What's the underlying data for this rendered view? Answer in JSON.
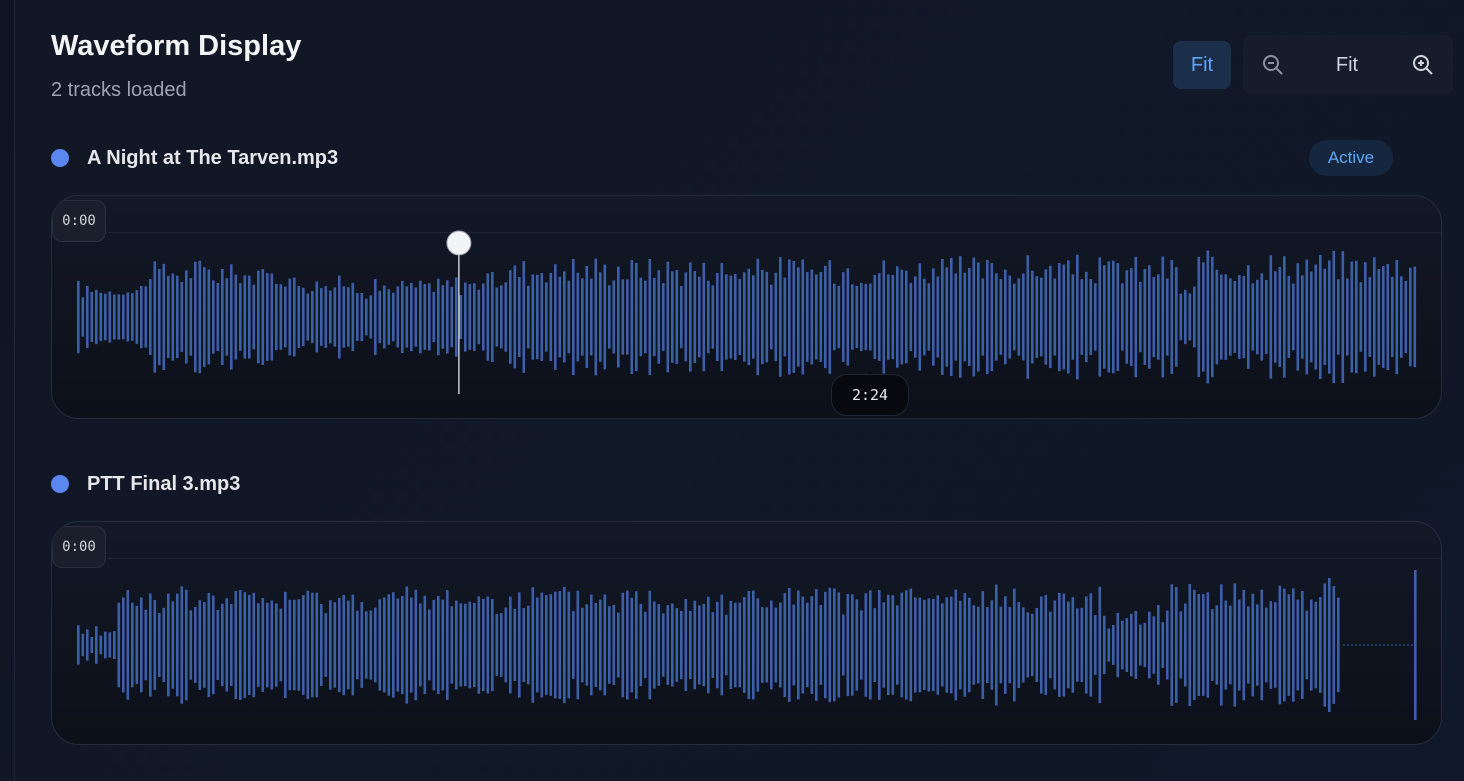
{
  "header": {
    "title": "Waveform Display",
    "subtitle": "2 tracks loaded"
  },
  "toolbar": {
    "fit_active_label": "Fit",
    "zoom_out_icon": "zoom-out-icon",
    "zoom_fit_label": "Fit",
    "zoom_in_icon": "zoom-in-icon"
  },
  "colors": {
    "accent": "#5b87f0",
    "waveform": "#3d5fa8",
    "badge_text": "#60a5fa"
  },
  "tracks": [
    {
      "name": "A Night at The Tarven.mp3",
      "status": "Active",
      "start_time": "0:00",
      "hover_time": "2:24",
      "playhead_fraction": 0.285
    },
    {
      "name": "PTT Final 3.mp3",
      "start_time": "0:00"
    }
  ]
}
